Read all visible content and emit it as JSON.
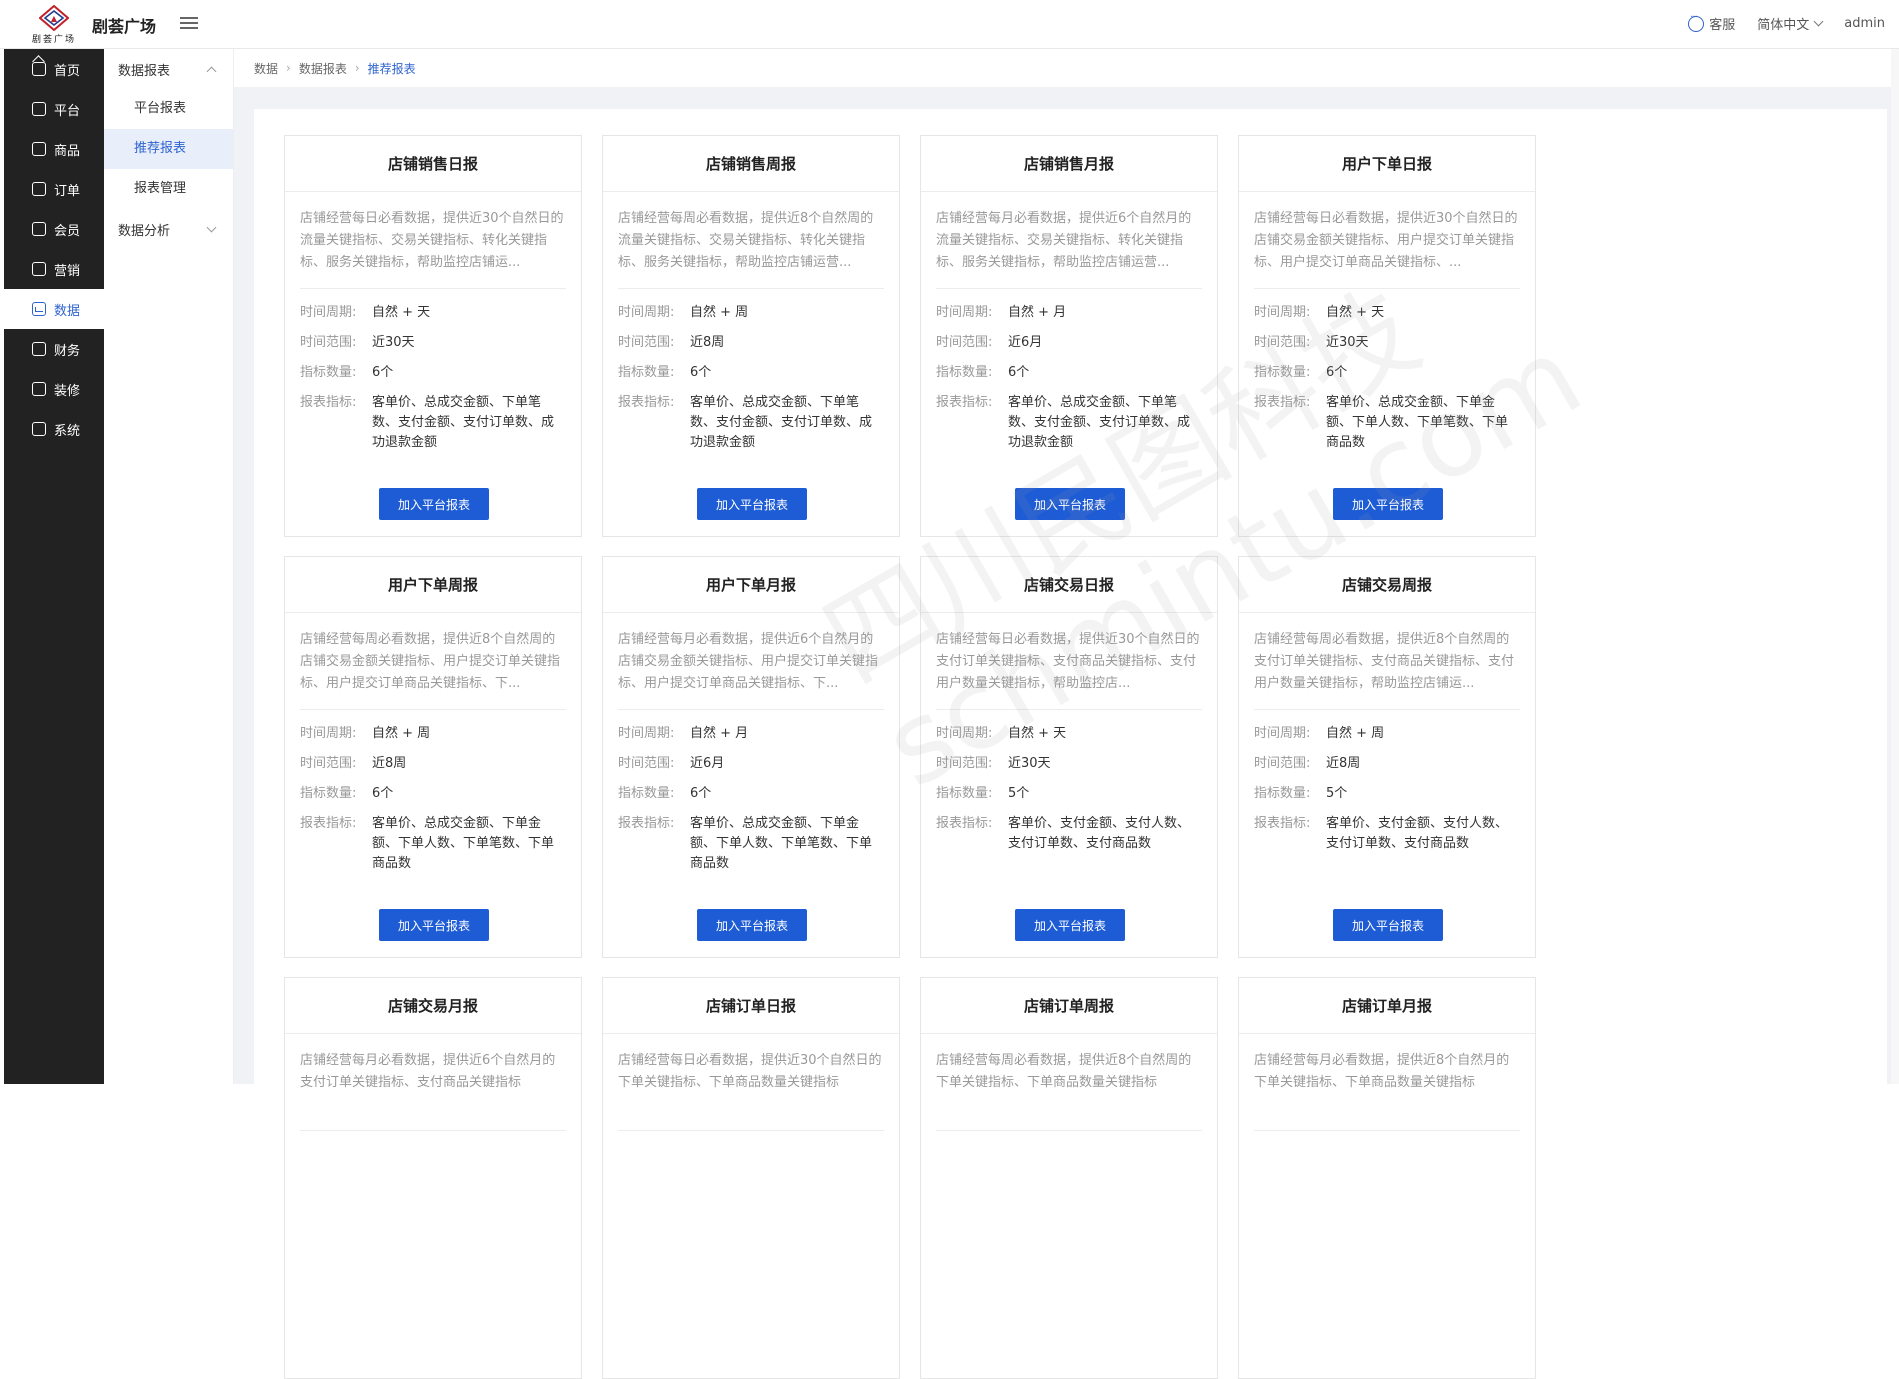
{
  "header": {
    "logo_text": "剧荟广场",
    "app_title": "剧荟广场",
    "service_label": "客服",
    "language_label": "简体中文",
    "user_label": "admin"
  },
  "sidebar_main": [
    {
      "label": "首页",
      "icon": "home-icon"
    },
    {
      "label": "平台",
      "icon": "monitor-icon"
    },
    {
      "label": "商品",
      "icon": "goods-icon"
    },
    {
      "label": "订单",
      "icon": "order-icon"
    },
    {
      "label": "会员",
      "icon": "member-icon"
    },
    {
      "label": "营销",
      "icon": "gift-icon"
    },
    {
      "label": "数据",
      "icon": "data-icon",
      "active": true
    },
    {
      "label": "财务",
      "icon": "finance-icon"
    },
    {
      "label": "装修",
      "icon": "decoration-icon"
    },
    {
      "label": "系统",
      "icon": "system-icon"
    }
  ],
  "sidebar_sub": {
    "group1": "数据报表",
    "items": [
      "平台报表",
      "推荐报表",
      "报表管理"
    ],
    "group2": "数据分析"
  },
  "breadcrumb": [
    "数据",
    "数据报表",
    "推荐报表"
  ],
  "labels": {
    "period": "时间周期:",
    "range": "时间范围:",
    "count": "指标数量:",
    "metrics": "报表指标:",
    "button": "加入平台报表"
  },
  "watermark": [
    "四川民图科技",
    "schmintu.com"
  ],
  "cards": [
    {
      "title": "店铺销售日报",
      "desc": "店铺经营每日必看数据，提供近30个自然日的流量关键指标、交易关键指标、转化关键指标、服务关键指标，帮助监控店铺运...",
      "period": "自然 + 天",
      "range": "近30天",
      "count": "6个",
      "metrics": "客单价、总成交金额、下单笔数、支付金额、支付订单数、成功退款金额"
    },
    {
      "title": "店铺销售周报",
      "desc": "店铺经营每周必看数据，提供近8个自然周的流量关键指标、交易关键指标、转化关键指标、服务关键指标，帮助监控店铺运营...",
      "period": "自然 + 周",
      "range": "近8周",
      "count": "6个",
      "metrics": "客单价、总成交金额、下单笔数、支付金额、支付订单数、成功退款金额"
    },
    {
      "title": "店铺销售月报",
      "desc": "店铺经营每月必看数据，提供近6个自然月的流量关键指标、交易关键指标、转化关键指标、服务关键指标，帮助监控店铺运营...",
      "period": "自然 + 月",
      "range": "近6月",
      "count": "6个",
      "metrics": "客单价、总成交金额、下单笔数、支付金额、支付订单数、成功退款金额"
    },
    {
      "title": "用户下单日报",
      "desc": "店铺经营每日必看数据，提供近30个自然日的店铺交易金额关键指标、用户提交订单关键指标、用户提交订单商品关键指标、...",
      "period": "自然 + 天",
      "range": "近30天",
      "count": "6个",
      "metrics": "客单价、总成交金额、下单金额、下单人数、下单笔数、下单商品数"
    },
    {
      "title": "用户下单周报",
      "desc": "店铺经营每周必看数据，提供近8个自然周的店铺交易金额关键指标、用户提交订单关键指标、用户提交订单商品关键指标、下...",
      "period": "自然 + 周",
      "range": "近8周",
      "count": "6个",
      "metrics": "客单价、总成交金额、下单金额、下单人数、下单笔数、下单商品数"
    },
    {
      "title": "用户下单月报",
      "desc": "店铺经营每月必看数据，提供近6个自然月的店铺交易金额关键指标、用户提交订单关键指标、用户提交订单商品关键指标、下...",
      "period": "自然 + 月",
      "range": "近6月",
      "count": "6个",
      "metrics": "客单价、总成交金额、下单金额、下单人数、下单笔数、下单商品数"
    },
    {
      "title": "店铺交易日报",
      "desc": "店铺经营每日必看数据，提供近30个自然日的支付订单关键指标、支付商品关键指标、支付用户数量关键指标，帮助监控店...",
      "period": "自然 + 天",
      "range": "近30天",
      "count": "5个",
      "metrics": "客单价、支付金额、支付人数、支付订单数、支付商品数"
    },
    {
      "title": "店铺交易周报",
      "desc": "店铺经营每周必看数据，提供近8个自然周的支付订单关键指标、支付商品关键指标、支付用户数量关键指标，帮助监控店铺运...",
      "period": "自然 + 周",
      "range": "近8周",
      "count": "5个",
      "metrics": "客单价、支付金额、支付人数、支付订单数、支付商品数"
    },
    {
      "title": "店铺交易月报",
      "desc": "店铺经营每月必看数据，提供近6个自然月的支付订单关键指标、支付商品关键指标",
      "period": "",
      "range": "",
      "count": "",
      "metrics": ""
    },
    {
      "title": "店铺订单日报",
      "desc": "店铺经营每日必看数据，提供近30个自然日的下单关键指标、下单商品数量关键指标",
      "period": "",
      "range": "",
      "count": "",
      "metrics": ""
    },
    {
      "title": "店铺订单周报",
      "desc": "店铺经营每周必看数据，提供近8个自然周的下单关键指标、下单商品数量关键指标",
      "period": "",
      "range": "",
      "count": "",
      "metrics": ""
    },
    {
      "title": "店铺订单月报",
      "desc": "店铺经营每月必看数据，提供近8个自然月的下单关键指标、下单商品数量关键指标",
      "period": "",
      "range": "",
      "count": "",
      "metrics": ""
    }
  ]
}
